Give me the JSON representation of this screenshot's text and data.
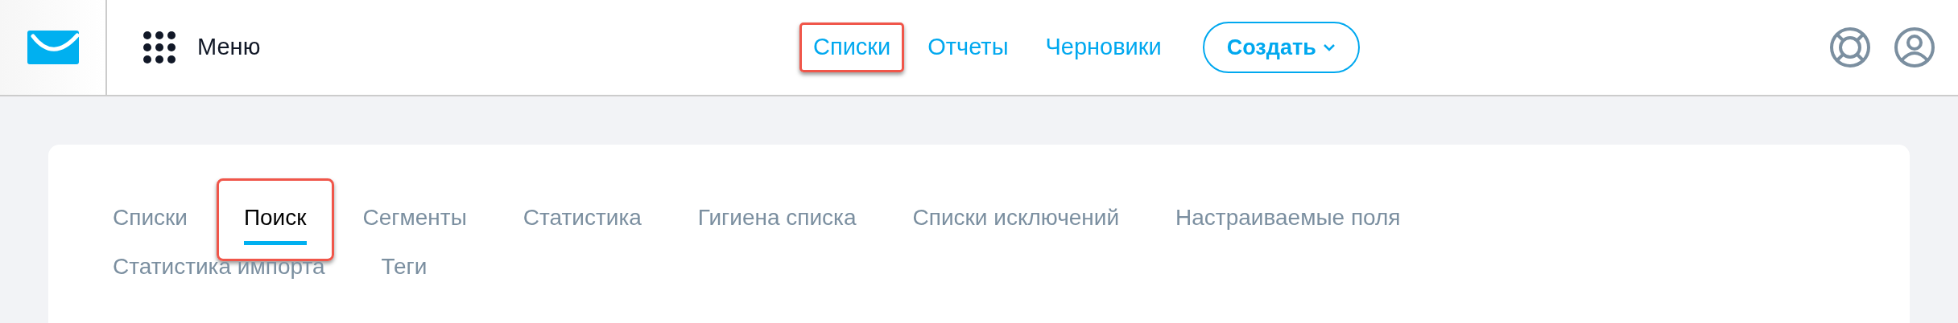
{
  "header": {
    "menu_label": "Меню",
    "nav": [
      {
        "label": "Списки",
        "highlighted": true
      },
      {
        "label": "Отчеты",
        "highlighted": false
      },
      {
        "label": "Черновики",
        "highlighted": false
      }
    ],
    "create_button": "Создать"
  },
  "tabs": [
    {
      "label": "Списки",
      "selected": false,
      "highlighted": false
    },
    {
      "label": "Поиск",
      "selected": true,
      "highlighted": true
    },
    {
      "label": "Сегменты",
      "selected": false,
      "highlighted": false
    },
    {
      "label": "Статистика",
      "selected": false,
      "highlighted": false
    },
    {
      "label": "Гигиена списка",
      "selected": false,
      "highlighted": false
    },
    {
      "label": "Списки исключений",
      "selected": false,
      "highlighted": false
    },
    {
      "label": "Настраиваемые поля",
      "selected": false,
      "highlighted": false
    },
    {
      "label": "Статистика импорта",
      "selected": false,
      "highlighted": false
    },
    {
      "label": "Теги",
      "selected": false,
      "highlighted": false
    }
  ]
}
